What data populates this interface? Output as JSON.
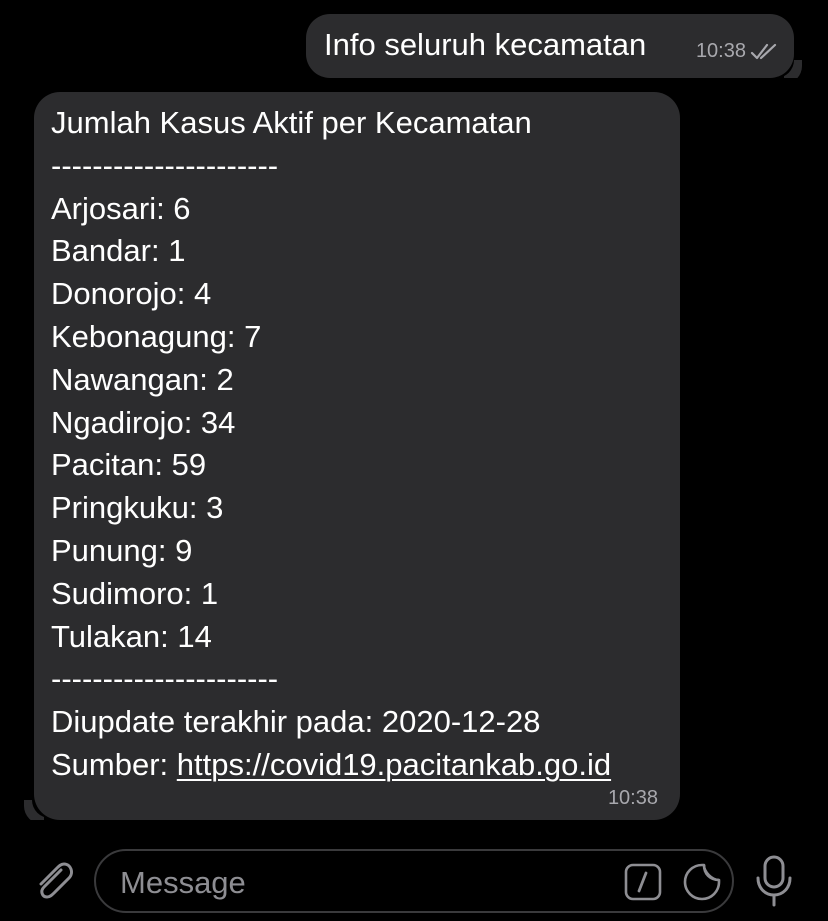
{
  "outgoing": {
    "text": "Info seluruh kecamatan",
    "time": "10:38"
  },
  "incoming": {
    "lines": [
      "Jumlah Kasus Aktif per Kecamatan",
      "----------------------",
      "Arjosari: 6",
      "Bandar: 1",
      "Donorojo: 4",
      "Kebonagung: 7",
      "Nawangan: 2",
      "Ngadirojo: 34",
      "Pacitan: 59",
      "Pringkuku: 3",
      "Punung: 9",
      "Sudimoro: 1",
      "Tulakan: 14",
      "----------------------",
      "Diupdate terakhir pada: 2020-12-28"
    ],
    "source_label": "Sumber: ",
    "source_link": "https://covid19.pacitankab.go.id",
    "time": "10:38"
  },
  "composer": {
    "placeholder": "Message"
  },
  "icons": {
    "attach": "paperclip-icon",
    "commands": "slash-command-icon",
    "sticker": "sticker-icon",
    "mic": "microphone-icon",
    "read_status": "double-check-icon"
  },
  "colors": {
    "background": "#000000",
    "bubble": "#2c2c2e",
    "meta": "#a8a8ad",
    "icon": "#8e8e93"
  }
}
